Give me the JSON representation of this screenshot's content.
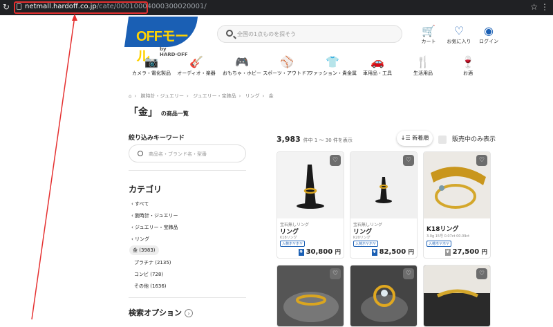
{
  "browser": {
    "url_host": "netmall.hardoff.co.jp",
    "url_path": "/cate/00010004000300020001/"
  },
  "header": {
    "logo_text": "OFFモール",
    "logo_by": "by HARD·OFF",
    "search_placeholder": "全国の1点ものを探そう",
    "cart_label": "カート",
    "fav_label": "お気に入り",
    "login_label": "ログイン"
  },
  "categories": [
    {
      "label": "カメラ・電化製品",
      "icon": "camera-icon",
      "glyph": "📷"
    },
    {
      "label": "オーディオ・楽器",
      "icon": "guitar-icon",
      "glyph": "🎸"
    },
    {
      "label": "おもちゃ・ホビー",
      "icon": "gamepad-icon",
      "glyph": "🎮"
    },
    {
      "label": "スポーツ・アウトドア",
      "icon": "baseball-icon",
      "glyph": "⚾"
    },
    {
      "label": "ファッション・貴金属",
      "icon": "tshirt-icon",
      "glyph": "👕"
    },
    {
      "label": "車用品・工具",
      "icon": "car-icon",
      "glyph": "🚗"
    },
    {
      "label": "生活用品",
      "icon": "cutlery-icon",
      "glyph": "🍴"
    },
    {
      "label": "お酒",
      "icon": "wine-icon",
      "glyph": "🍷"
    }
  ],
  "breadcrumb": [
    "腕時計・ジュエリー",
    "ジュエリー・宝飾品",
    "リング",
    "金"
  ],
  "page_title": "「金」",
  "page_title_suffix": "の商品一覧",
  "sidebar": {
    "keyword_heading": "絞り込みキーワード",
    "keyword_placeholder": "商品名・ブランド名・型番",
    "category_heading": "カテゴリ",
    "items": [
      "すべて",
      "腕時計・ジュエリー",
      "ジュエリー・宝飾品",
      "リング"
    ],
    "current": "金 (3983)",
    "subs": [
      "プラチナ (2135)",
      "コンビ (728)",
      "その他 (1636)"
    ],
    "options_heading": "検索オプション"
  },
  "results": {
    "total": "3,983",
    "range_text": "件中 1 〜 30 件を表示",
    "sort_label": "新着順",
    "onsale_label": "販売中のみ表示"
  },
  "products": [
    {
      "brand": "宝石無しリング",
      "name": "リング",
      "sub": "K18リング",
      "tag": "入荷ホヤホヤ",
      "price": "30,800",
      "price_suffix": "円",
      "yen_used": false
    },
    {
      "brand": "宝石無しリング",
      "name": "リング",
      "sub": "K20リング",
      "tag": "入荷ホヤホヤ",
      "price": "82,500",
      "price_suffix": "円",
      "yen_used": false
    },
    {
      "brand": "",
      "name": "K18リング",
      "sub": "3.0g 15号 0.07ct 00.09ct",
      "tag": "入荷ホヤホヤ",
      "price": "27,500",
      "price_suffix": "円",
      "yen_used": true
    }
  ]
}
